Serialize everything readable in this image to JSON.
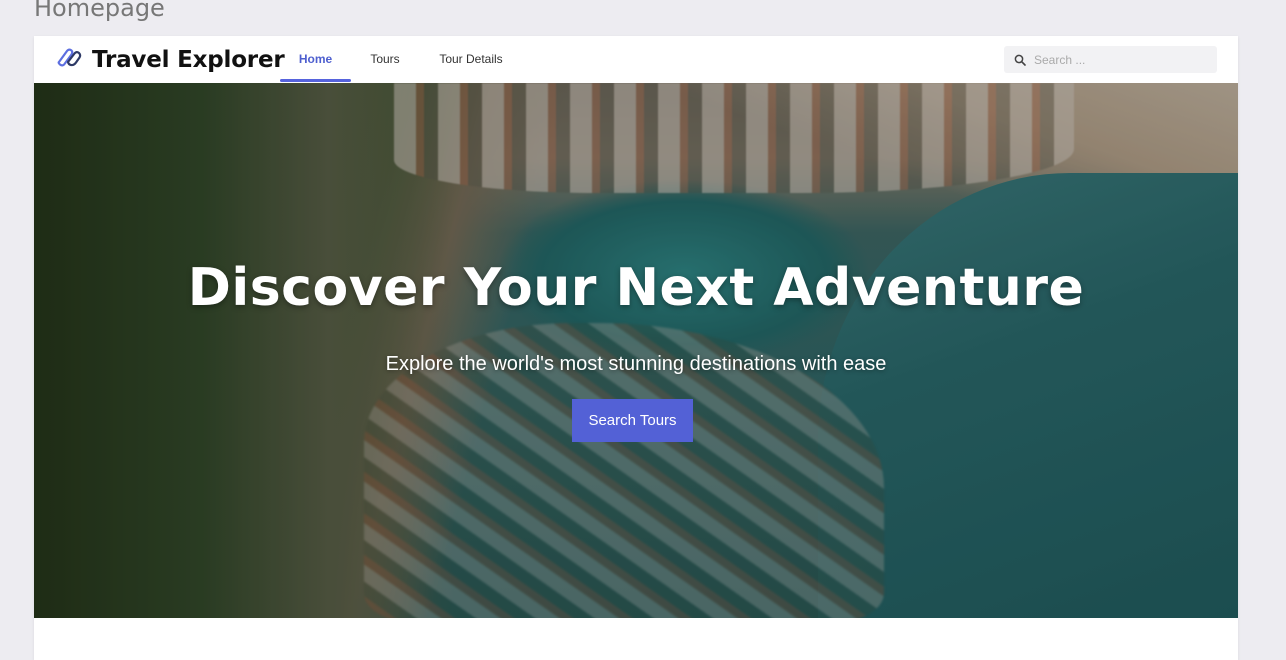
{
  "canvas": {
    "label": "Homepage"
  },
  "brand": {
    "name": "Travel Explorer",
    "icon": "cloud-link-icon",
    "accent": "#5663dd"
  },
  "nav": {
    "items": [
      {
        "label": "Home",
        "active": true
      },
      {
        "label": "Tours",
        "active": false
      },
      {
        "label": "Tour Details",
        "active": false
      }
    ]
  },
  "search": {
    "placeholder": "Search ...",
    "value": ""
  },
  "hero": {
    "title": "Discover Your Next Adventure",
    "subtitle": "Explore the world's most stunning destinations with ease",
    "cta_label": "Search Tours",
    "image": "coastal-town-aerial-image"
  }
}
